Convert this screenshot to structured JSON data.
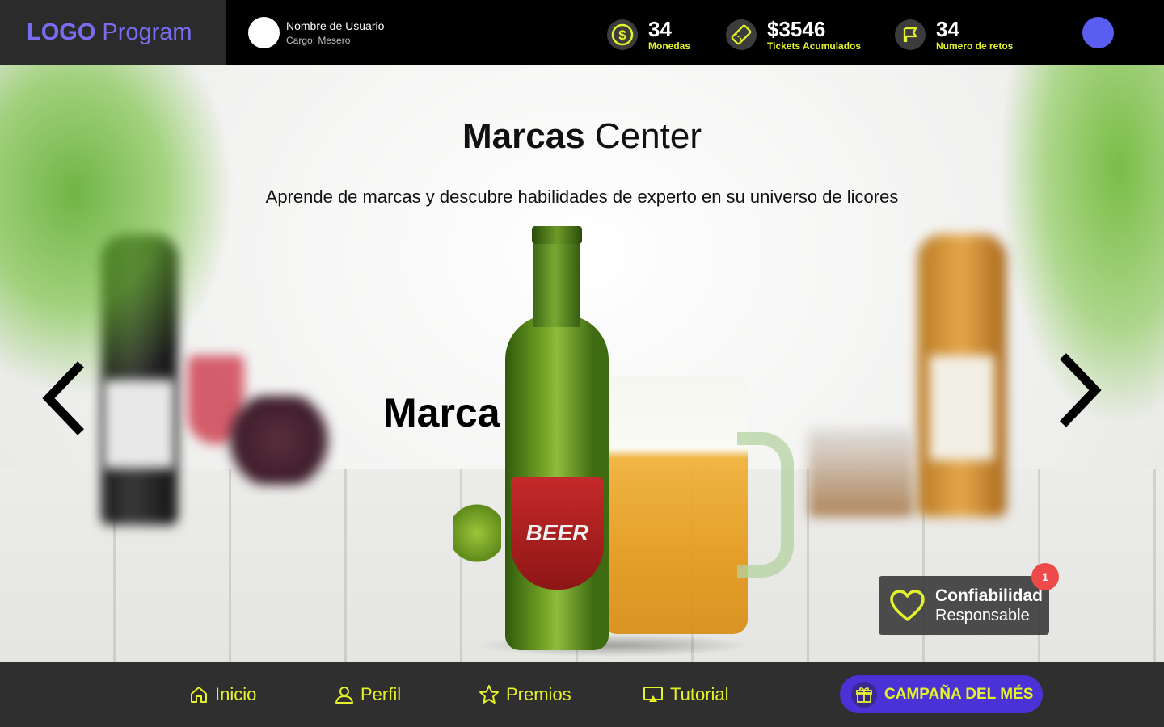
{
  "header": {
    "logo_strong": "LOGO",
    "logo_light": "Program",
    "user": {
      "name": "Nombre de Usuario",
      "role": "Cargo: Mesero"
    },
    "stats": [
      {
        "value": "34",
        "label": "Monedas",
        "icon": "coin-icon"
      },
      {
        "value": "$3546",
        "label": "Tickets Acumulados",
        "icon": "ticket-icon"
      },
      {
        "value": "34",
        "label": "Numero de retos",
        "icon": "flag-icon"
      }
    ]
  },
  "main": {
    "title_bold": "Marcas",
    "title_light": "Center",
    "subtitle": "Aprende de marcas y descubre habilidades de experto en su universo de licores",
    "brand_label": "Marca",
    "product_label_text": "BEER",
    "trust_card": {
      "title": "Confiabilidad",
      "subtitle": "Responsable",
      "badge_count": "1"
    }
  },
  "nav": {
    "items": [
      {
        "label": "Inicio",
        "icon": "home-icon"
      },
      {
        "label": "Perfil",
        "icon": "user-icon"
      },
      {
        "label": "Premios",
        "icon": "star-icon"
      },
      {
        "label": "Tutorial",
        "icon": "screen-icon"
      }
    ],
    "campaign_label": "CAMPAÑA DEL MÉS"
  },
  "colors": {
    "accent_yellow": "#e4f22c",
    "brand_purple": "#7a6cf0",
    "campaign_purple": "#4a32d6",
    "status_blue": "#5a5ef0",
    "badge_red": "#ef4a4a"
  }
}
